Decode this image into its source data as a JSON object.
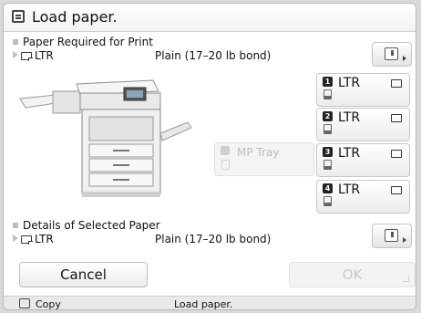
{
  "title": "Load paper.",
  "required": {
    "heading": "Paper Required for Print",
    "size": "LTR",
    "type": "Plain (17–20 lb bond)"
  },
  "selected": {
    "heading": "Details of Selected Paper",
    "size": "LTR",
    "type": "Plain (17–20 lb bond)"
  },
  "drawers": [
    {
      "num": "1",
      "label": "LTR"
    },
    {
      "num": "2",
      "label": "LTR"
    },
    {
      "num": "3",
      "label": "LTR"
    },
    {
      "num": "4",
      "label": "LTR"
    }
  ],
  "mp_tray": {
    "label": "MP Tray"
  },
  "buttons": {
    "cancel": "Cancel",
    "ok": "OK"
  },
  "status": {
    "mode": "Copy",
    "message": "Load paper."
  }
}
